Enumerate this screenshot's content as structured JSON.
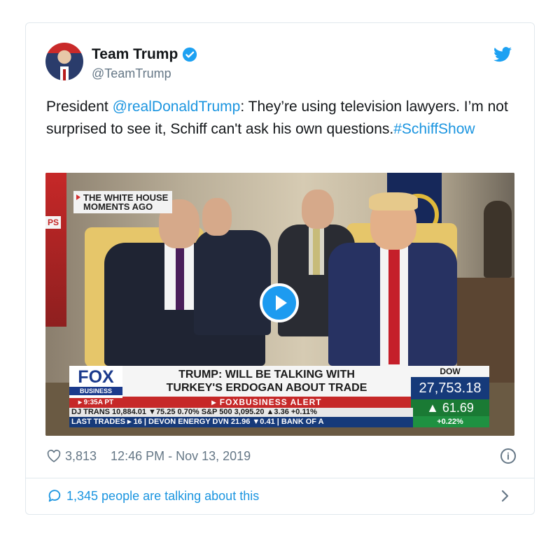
{
  "tweet": {
    "author_name": "Team Trump",
    "author_handle": "@TeamTrump",
    "text_prefix": "President ",
    "mention": "@realDonaldTrump",
    "text_body": ": They’re using television lawyers. I’m not surprised to see it, Schiff can't ask his own questions.",
    "hashtag": "#SchiffShow",
    "likes": "3,813",
    "timestamp": "12:46 PM - Nov 13, 2019",
    "talking": "1,345 people are talking about this"
  },
  "video": {
    "corner_tag_line1": "THE WHITE HOUSE",
    "corner_tag_line2": "MOMENTS AGO",
    "side_tag": "PS",
    "network_logo": "FOX",
    "network_sub": "BUSINESS",
    "network_time": "▸ 9:35A PT",
    "headline_line1": "TRUMP: WILL BE TALKING WITH",
    "headline_line2": "TURKEY'S ERDOGAN ABOUT TRADE",
    "alert": "▸ FOXBUSINESS ALERT",
    "dow_label": "DOW",
    "dow_value": "27,753.18",
    "dow_change": "▲ 61.69",
    "dow_pct": "+0.22%",
    "ticker_line1": "DJ TRANS 10,884.01 ▼75.25 0.70% S&P 500   3,095.20 ▲3.36 +0.11%",
    "ticker_line2": "LAST TRADES ▸ 16 | DEVON ENERGY DVN 21.96 ▼0.41 | BANK OF A"
  },
  "colors": {
    "link": "#1b95e0",
    "verified": "#1da1f2",
    "meta": "#657786"
  },
  "icons": {
    "verified": "verified-badge-icon",
    "bird": "twitter-bird-icon",
    "heart": "heart-icon",
    "info": "info-icon",
    "bubble": "comment-bubble-icon",
    "chevron": "chevron-right-icon",
    "play": "play-icon"
  }
}
